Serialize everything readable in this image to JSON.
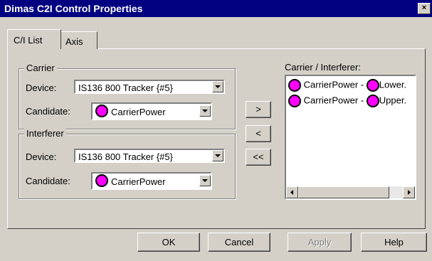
{
  "window": {
    "title": "Dimas C2I Control Properties",
    "close_glyph": "×"
  },
  "tabs": [
    {
      "label": "C/I List"
    },
    {
      "label": "Axis"
    }
  ],
  "carrier": {
    "group_label": "Carrier",
    "device_label": "Device:",
    "device_value": "IS136 800 Tracker {#5}",
    "candidate_label": "Candidate:",
    "candidate_value": "CarrierPower"
  },
  "interferer": {
    "group_label": "Interferer",
    "device_label": "Device:",
    "device_value": "IS136 800 Tracker {#5}",
    "candidate_label": "Candidate:",
    "candidate_value": "CarrierPower"
  },
  "move_buttons": {
    "add": ">",
    "remove": "<",
    "remove_all": "<<"
  },
  "list": {
    "label": "Carrier / Interferer:",
    "items": [
      {
        "left": "CarrierPower -",
        "right": "Lower."
      },
      {
        "left": "CarrierPower -",
        "right": "Upper."
      }
    ]
  },
  "footer": {
    "ok": "OK",
    "cancel": "Cancel",
    "apply": "Apply",
    "help": "Help"
  },
  "colors": {
    "titlebar": "#000080",
    "marker": "#ff00ff",
    "face": "#d4d0c8"
  }
}
